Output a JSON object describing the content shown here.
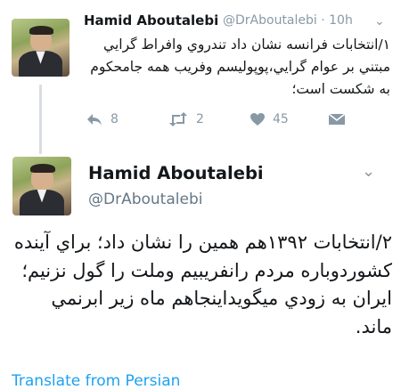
{
  "tweet1": {
    "name": "Hamid Aboutalebi",
    "handle": "@DrAboutalebi",
    "time": "· 10h",
    "text": "١/انتخابات فرانسه نشان داد تندروي وافراط گرايي مبتني بر عوام گرايي،پوپوليسم وفريب همه جامحكوم به شكست است؛",
    "reply_count": "8",
    "retweet_count": "2",
    "like_count": "45",
    "icons": {
      "reply": "reply-icon",
      "retweet": "retweet-icon",
      "like": "heart-icon",
      "message": "envelope-icon",
      "more": "chevron-down-icon"
    }
  },
  "tweet2": {
    "name": "Hamid Aboutalebi",
    "handle": "@DrAboutalebi",
    "text": "٢/انتخابات ١٣٩٢هم همين را نشان داد؛ براي آينده كشوردوباره مردم رانفريبيم وملت را گول نزنيم؛ايران به زودي ميگويداينجاهم ماه زير ابرنمي ماند.",
    "translate_label": "Translate from Persian"
  },
  "colors": {
    "accent": "#1da1f2",
    "muted": "#8899a6",
    "text": "#14171a"
  }
}
